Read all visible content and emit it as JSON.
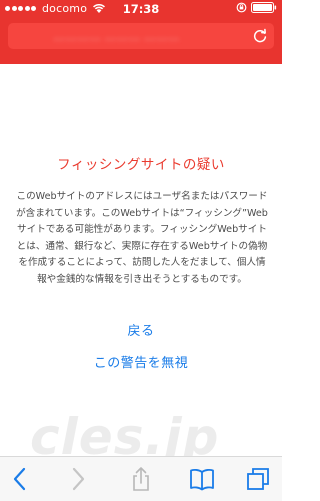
{
  "status_bar": {
    "carrier": "docomo",
    "time": "17:38"
  },
  "address_bar": {
    "url_text": "………… ……… ………"
  },
  "warning": {
    "title": "フィッシングサイトの疑い",
    "lines": [
      "このWebサイトのアドレスにはユーザ名またはパスワード",
      "が含まれています。このWebサイトは“フィッシング”Web",
      "サイトである可能性があります。フィッシングWebサイト",
      "とは、通常、銀行など、実際に存在するWebサイトの偽物",
      "を作成することによって、訪問した人をだまして、個人情",
      "報や金銭的な情報を引き出そうとするものです。"
    ],
    "back_label": "戻る",
    "ignore_label": "この警告を無視"
  },
  "watermark": "cles.jp",
  "colors": {
    "header_bg": "#e8342f",
    "title": "#ea3b2f",
    "link": "#1a7ce8",
    "toolbar_icon": "#1a7ce8"
  },
  "toolbar": {
    "icons": [
      "back-icon",
      "forward-icon",
      "share-icon",
      "bookmarks-icon",
      "tabs-icon"
    ]
  }
}
